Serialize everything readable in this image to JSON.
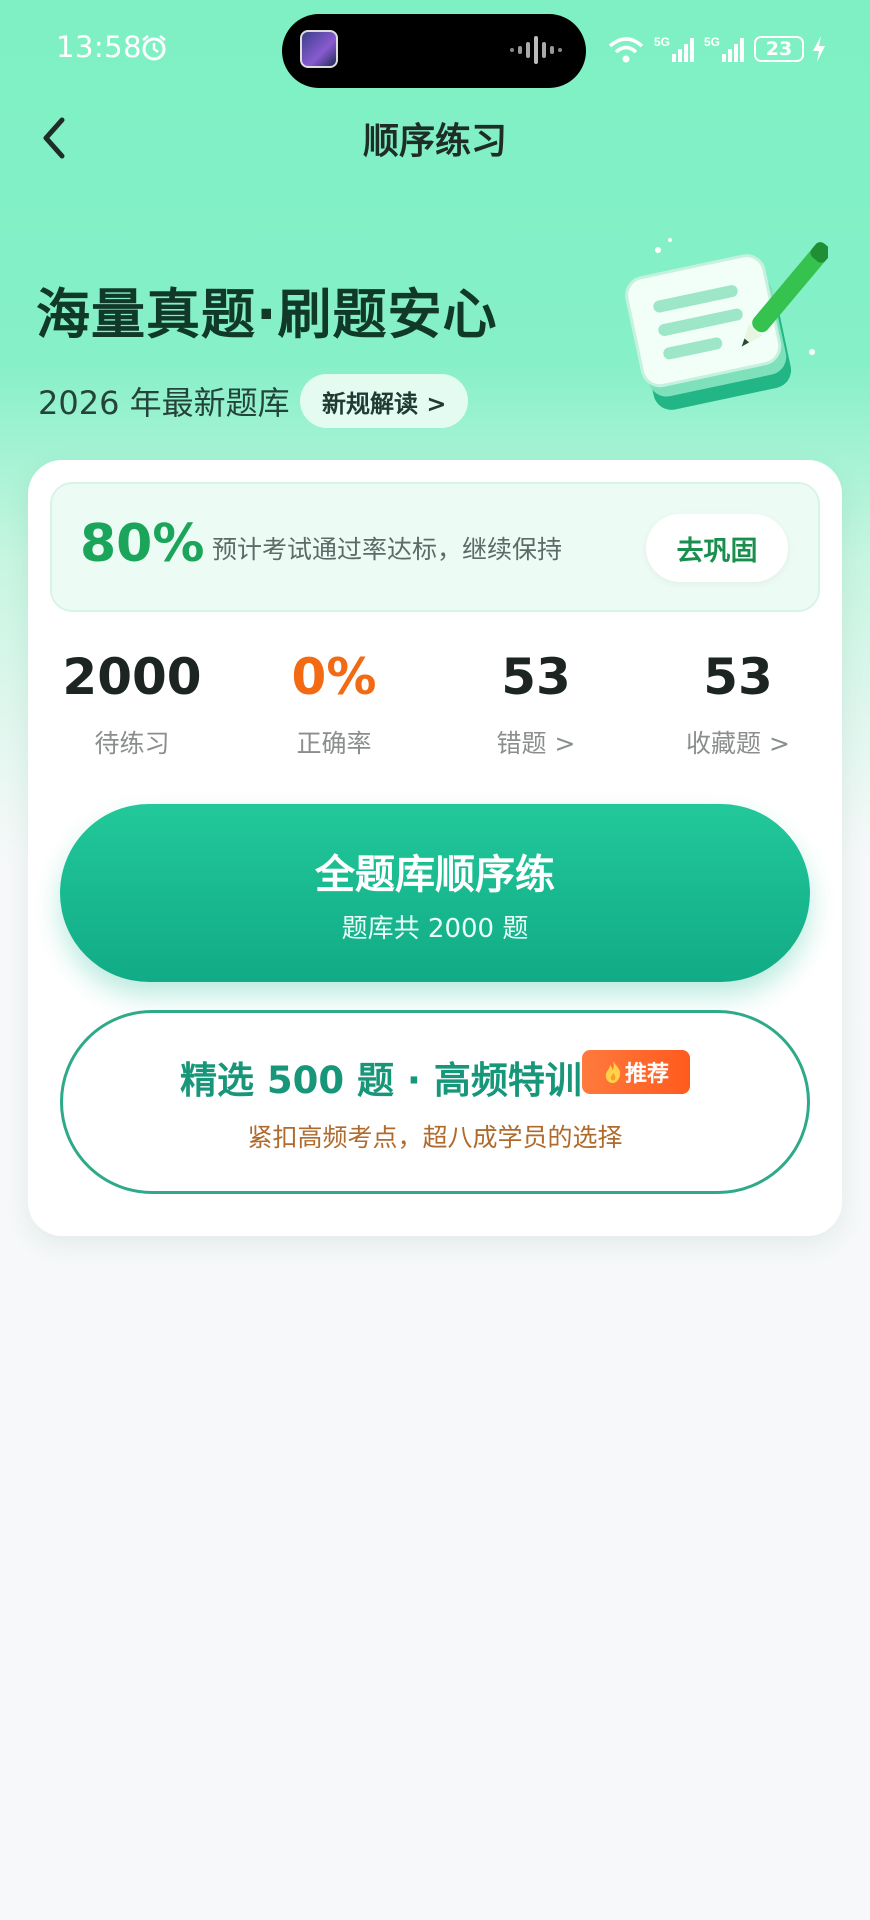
{
  "status_bar": {
    "time": "13:58",
    "battery": "23",
    "icons": [
      "alarm-icon",
      "wifi-icon",
      "signal-5g-icon",
      "signal-5g-icon",
      "battery-icon",
      "charging-icon"
    ]
  },
  "nav": {
    "title": "顺序练习",
    "back_icon": "chevron-left-icon"
  },
  "hero": {
    "title": "海量真题·刷题安心",
    "subtitle": "2026 年最新题库",
    "tag": "新规解读 >",
    "illustration": "notepad-pen-icon"
  },
  "pass": {
    "percent": "80%",
    "text": "预计考试通过率达标，继续保持",
    "button": "去巩固"
  },
  "stats": [
    {
      "value": "2000",
      "label": "待练习",
      "color": "#1c2522"
    },
    {
      "value": "0%",
      "label": "正确率",
      "color": "#f26a14"
    },
    {
      "value": "53",
      "label": "错题 >",
      "color": "#1c2522"
    },
    {
      "value": "53",
      "label": "收藏题 >",
      "color": "#1c2522"
    }
  ],
  "primary": {
    "title": "全题库顺序练",
    "subtitle": "题库共 2000 题"
  },
  "secondary": {
    "title": "精选 500 题 · 高频特训",
    "badge": "推荐",
    "badge_icon": "fire-icon",
    "subtitle": "紧扣高频考点，超八成学员的选择"
  },
  "colors": {
    "accent": "#1aa55b",
    "primary_button": "#15b58c",
    "orange": "#f26a14"
  }
}
